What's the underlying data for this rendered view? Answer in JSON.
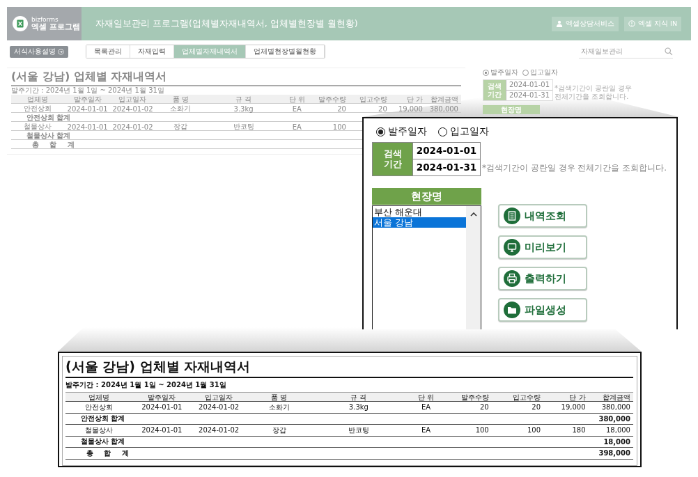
{
  "header": {
    "brand": "bizforms",
    "product": "엑셀 프로그램",
    "title": "자재일보관리 프로그램(업체별자재내역서, 업체별현장별 월현황)",
    "links": [
      {
        "label": "엑셀상담서비스",
        "kind": "person"
      },
      {
        "label": "엑셀 지식 IN",
        "kind": "info"
      }
    ]
  },
  "toolbar": {
    "guide_button": "서식사용설명",
    "tabs": [
      {
        "label": "목록관리",
        "selected": false
      },
      {
        "label": "자재입력",
        "selected": false
      },
      {
        "label": "업체별자재내역서",
        "selected": true
      },
      {
        "label": "업체별현장별월현황",
        "selected": false
      }
    ],
    "search": {
      "placeholder": "자재일보관리"
    }
  },
  "report": {
    "title": "(서울 강남) 업체별 자재내역서",
    "period": "발주기간 : 2024년 1월 1일 ~ 2024년 1월 31일",
    "columns": [
      "업체명",
      "발주일자",
      "입고일자",
      "품 명",
      "규 격",
      "단 위",
      "발주수량",
      "입고수량",
      "단 가",
      "합계금액"
    ],
    "rows": [
      {
        "kind": "item",
        "cells": [
          "안전상회",
          "2024-01-01",
          "2024-01-02",
          "소화기",
          "3.3kg",
          "EA",
          "20",
          "20",
          "19,000",
          "380,000"
        ]
      },
      {
        "kind": "subtotal",
        "label": "안전상회 합계"
      },
      {
        "kind": "item",
        "cells": [
          "철물상사",
          "2024-01-01",
          "2024-01-02",
          "장갑",
          "반코팅",
          "EA",
          "100"
        ]
      },
      {
        "kind": "subtotal",
        "label": "철물상사 합계"
      },
      {
        "kind": "total",
        "label": "총 합 계"
      }
    ]
  },
  "search": {
    "date_types": [
      {
        "label": "발주일자",
        "selected": true
      },
      {
        "label": "입고일자",
        "selected": false
      }
    ],
    "period_label": "검색 기간",
    "start": "2024-01-01",
    "end": "2024-01-31",
    "note": "*검색기간이 공란일 경우 전체기간을 조회합니다.",
    "site_header": "현장명"
  },
  "zoom_search": {
    "date_types": [
      {
        "label": "발주일자",
        "selected": true
      },
      {
        "label": "입고일자",
        "selected": false
      }
    ],
    "period_label": "검색 기간",
    "start": "2024-01-01",
    "end": "2024-01-31",
    "note": "*검색기간이 공란일 경우 전체기간을 조회합니다.",
    "site_header": "현장명",
    "sites": [
      {
        "label": "부산 해운대",
        "selected": false
      },
      {
        "label": "서울 강남",
        "selected": true
      }
    ],
    "actions": [
      {
        "label": "내역조회",
        "kind": "list"
      },
      {
        "label": "미리보기",
        "kind": "monitor"
      },
      {
        "label": "출력하기",
        "kind": "printer"
      },
      {
        "label": "파일생성",
        "kind": "folder"
      }
    ]
  },
  "zoom_report": {
    "title": "(서울 강남) 업체별 자재내역서",
    "period": "발주기간 : 2024년 1월 1일 ~ 2024년 1월 31일",
    "columns": [
      "업체명",
      "발주일자",
      "입고일자",
      "품 명",
      "규 격",
      "단 위",
      "발주수량",
      "입고수량",
      "단 가",
      "합계금액"
    ],
    "rows": [
      {
        "kind": "item",
        "cells": [
          "안전상회",
          "2024-01-01",
          "2024-01-02",
          "소화기",
          "3.3kg",
          "EA",
          "20",
          "20",
          "19,000",
          "380,000"
        ]
      },
      {
        "kind": "subtotal",
        "label": "안전상회 합계",
        "amount": "380,000"
      },
      {
        "kind": "item",
        "cells": [
          "철물상사",
          "2024-01-01",
          "2024-01-02",
          "장갑",
          "반코팅",
          "EA",
          "100",
          "100",
          "180",
          "18,000"
        ]
      },
      {
        "kind": "subtotal",
        "label": "철물상사 합계",
        "amount": "18,000"
      },
      {
        "kind": "total",
        "label": "총 합 계",
        "amount": "398,000"
      }
    ]
  }
}
